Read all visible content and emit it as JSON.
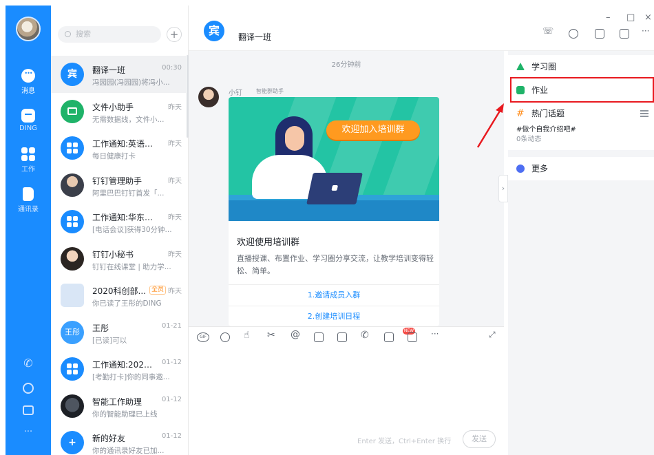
{
  "window": {
    "controls": {
      "minimize": "–",
      "maximize": "□",
      "close": "×"
    }
  },
  "nav": {
    "items": [
      {
        "label": "消息",
        "icon": "chat-icon"
      },
      {
        "label": "DING",
        "icon": "calendar-icon"
      },
      {
        "label": "工作",
        "icon": "grid-icon"
      },
      {
        "label": "通讯录",
        "icon": "contacts-icon"
      }
    ],
    "bottom_icons": [
      "phone-icon",
      "cloud-icon",
      "mail-icon",
      "more-icon"
    ],
    "more_label": "···"
  },
  "search": {
    "placeholder": "搜索",
    "add_label": "+"
  },
  "conversations": [
    {
      "title": "翻译一班",
      "time": "00:30",
      "preview": "冯园园(冯园园)将冯小...",
      "avatar": "blue"
    },
    {
      "title": "文件小助手",
      "time": "昨天",
      "preview": "无需数据线，文件小...",
      "avatar": "green"
    },
    {
      "title": "工作通知:英语精...",
      "time": "昨天",
      "preview": "每日健康打卡",
      "avatar": "blue"
    },
    {
      "title": "钉钉管理助手",
      "time": "昨天",
      "preview": "阿里巴巴钉钉首发「...",
      "avatar": "photo"
    },
    {
      "title": "工作通知:华东师...",
      "time": "昨天",
      "preview": "[电话会议]获得30分钟...",
      "avatar": "blue"
    },
    {
      "title": "钉钉小秘书",
      "time": "昨天",
      "preview": "钉钉在线课堂 | 助力学...",
      "avatar": "photo2"
    },
    {
      "title": "2020科创部...",
      "time": "昨天",
      "preview": "你已读了王彤的DING",
      "avatar": "group",
      "badge": "全员"
    },
    {
      "title": "王彤",
      "time": "01-21",
      "preview": "[已读]可以",
      "avatar": "light",
      "avatar_text": "王彤"
    },
    {
      "title": "工作通知:2020科...",
      "time": "01-12",
      "preview": "[考勤打卡]你的同事邀...",
      "avatar": "blue"
    },
    {
      "title": "智能工作助理",
      "time": "01-12",
      "preview": "你的智能助理已上线",
      "avatar": "dark"
    },
    {
      "title": "新的好友",
      "time": "01-12",
      "preview": "你的通讯录好友已加...",
      "avatar": "blue"
    }
  ],
  "chat": {
    "title": "翻译一班",
    "icon_char": "宾",
    "time_separator": "26分钟前",
    "sender_name": "小钉",
    "sender_tag": "智能群助手",
    "card": {
      "banner_text": "欢迎加入培训群",
      "title": "欢迎使用培训群",
      "description": "直播授课、布置作业、学习圈分享交流，让教学培训变得轻松、简单。",
      "links": [
        "1.邀请成员入群",
        "2.创建培训日程"
      ]
    },
    "input_hint": "Enter 发送，Ctrl+Enter 换行",
    "send_label": "发送",
    "new_badge": "NEW",
    "gif_label": "GIF"
  },
  "right_panel": {
    "items": [
      {
        "label": "学习圈",
        "icon": "learning-circle-icon"
      },
      {
        "label": "作业",
        "icon": "homework-icon"
      },
      {
        "label": "热门话题",
        "icon": "hashtag-icon"
      }
    ],
    "topic_title": "#做个自我介绍吧#",
    "topic_sub": "0条动态",
    "more_label": "更多"
  },
  "colors": {
    "accent": "#1a8cff",
    "highlight": "#e8191f",
    "banner": "#23c4a4",
    "welcome": "#ff9a1f"
  }
}
